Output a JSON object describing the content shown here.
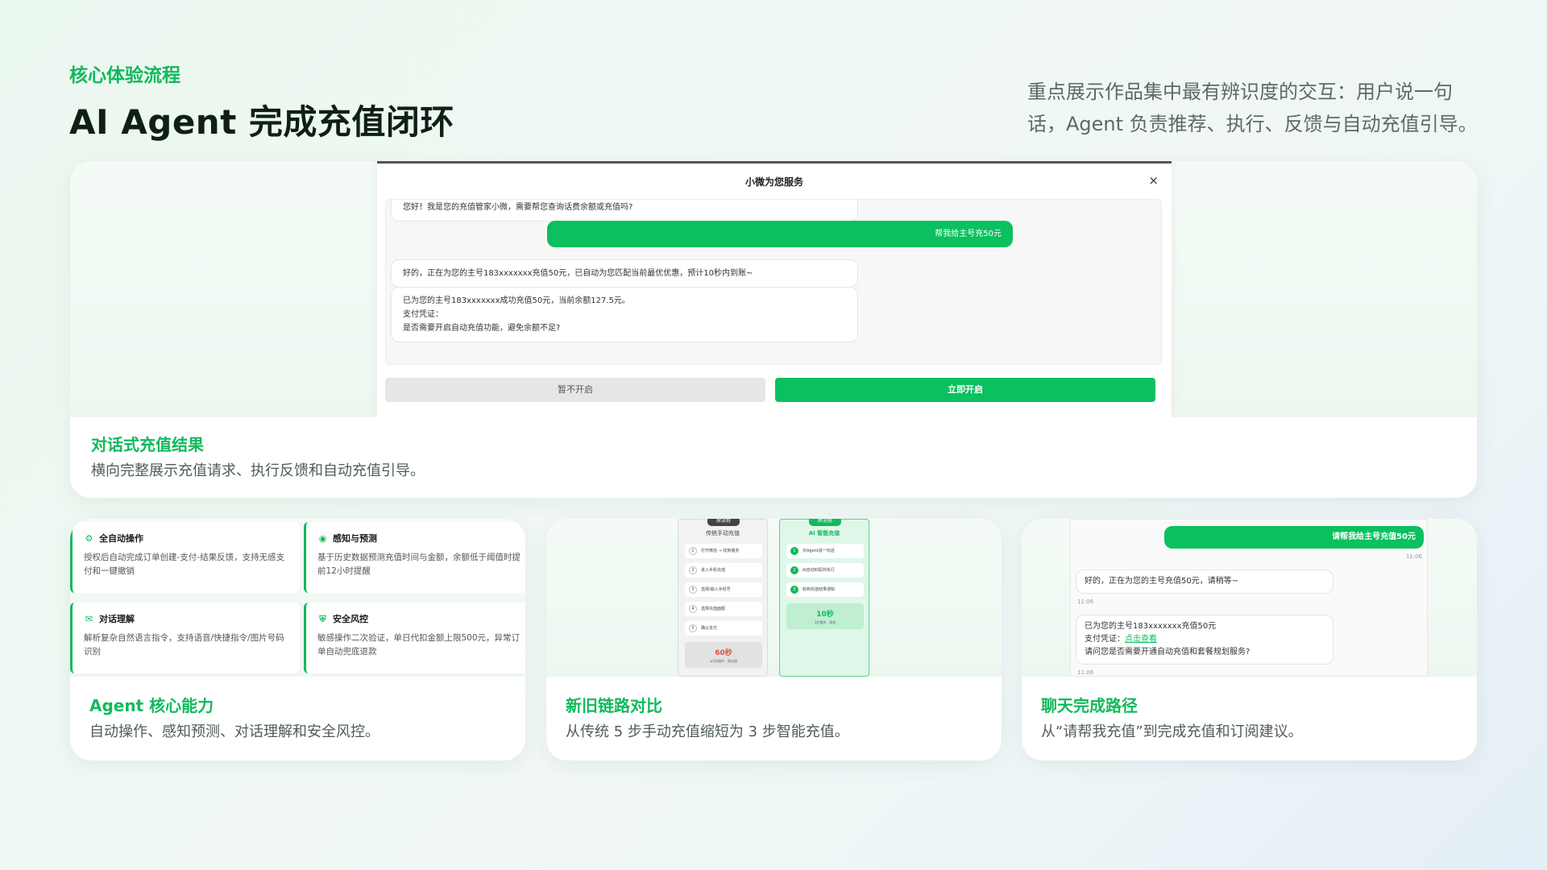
{
  "header": {
    "eyebrow": "核心体验流程",
    "title": "AI Agent 完成充值闭环",
    "intro": "重点展示作品集中最有辨识度的交互：用户说一句话，Agent 负责推荐、执行、反馈与自动充值引导。"
  },
  "top_card": {
    "dialog_title": "小微为您服务",
    "close": "×",
    "messages": [
      {
        "role": "agent",
        "text": "您好！我是您的充值管家小微，需要帮您查询话费余额或充值吗?"
      },
      {
        "role": "user",
        "text": "帮我给主号充50元"
      },
      {
        "role": "agent",
        "text": "好的，正在为您的主号183xxxxxxx充值50元，已自动为您匹配当前最优优惠，预计10秒内到账~"
      },
      {
        "role": "agent",
        "lines": [
          "已为您的主号183xxxxxxx成功充值50元，当前余额127.5元。",
          "支付凭证：",
          "是否需要开启自动充值功能，避免余额不足?"
        ]
      }
    ],
    "btn_decline": "暂不开启",
    "btn_accept": "立即开启",
    "caption_title": "对话式充值结果",
    "caption_desc": "横向完整展示充值请求、执行反馈和自动充值引导。"
  },
  "capabilities": {
    "features": [
      {
        "icon": "gears-icon",
        "title": "全自动操作",
        "desc": "授权后自动完成订单创建-支付-结果反馈，支持无感支付和一键撤销"
      },
      {
        "icon": "eye-icon",
        "title": "感知与预测",
        "desc": "基于历史数据预测充值时间与金额，余额低于阈值时提前12小时提醒"
      },
      {
        "icon": "chat-icon",
        "title": "对话理解",
        "desc": "解析复杂自然语言指令，支持语音/快捷指令/图片号码识别"
      },
      {
        "icon": "shield-icon",
        "title": "安全风控",
        "desc": "敏感操作二次验证，单日代扣金额上限500元，异常订单自动兜底退款"
      }
    ],
    "caption_title": "Agent 核心能力",
    "caption_desc": "自动操作、感知预测、对话理解和安全风控。"
  },
  "comparison": {
    "old": {
      "badge": "原流程",
      "title": "传统手动充值",
      "steps": [
        "打开微信 → 找到服务",
        "进入手机充值",
        "选择/输入手机号",
        "选择充值面额",
        "确认支付"
      ],
      "time": "60秒",
      "time_note": "≥5次操作 · 易出错"
    },
    "new": {
      "badge": "新流程",
      "title": "AI 智能充值",
      "steps": [
        "对Agent说一句话",
        "AI自动匹配并执行",
        "收到充值结果通知"
      ],
      "time": "10秒",
      "time_note": "3步操作 · 高效"
    },
    "caption_title": "新旧链路对比",
    "caption_desc": "从传统 5 步手动充值缩短为 3 步智能充值。"
  },
  "chat_path": {
    "user_msg": "请帮我给主号充值50元",
    "time1": "11:06",
    "reply1": "好的，正在为您的主号充值50元，请稍等~",
    "time2": "11:06",
    "reply2_line1": "已为您的主号183xxxxxxx充值50元",
    "reply2_label": "支付凭证：",
    "reply2_link": "点击查看",
    "reply2_line3": "请问您是否需要开通自动充值和套餐规划服务?",
    "time3": "11:06",
    "caption_title": "聊天完成路径",
    "caption_desc": "从“请帮我充值”到完成充值和订阅建议。"
  },
  "colors": {
    "accent": "#12b95c",
    "bubble_user": "#0bc05e"
  }
}
